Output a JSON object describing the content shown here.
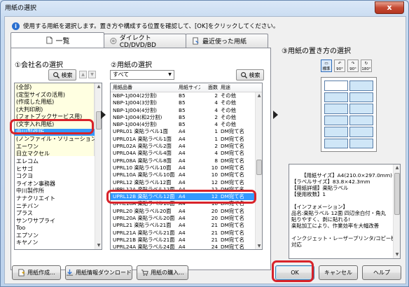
{
  "window": {
    "title": "用紙の選択",
    "close_label": "x"
  },
  "instruction": "使用する用紙を選択します。置き方や構成する位置を確認して、[OK]をクリックしてください。",
  "tabs": [
    {
      "label": "一覧"
    },
    {
      "label": "ダイレクトCD/DVD/BD"
    },
    {
      "label": "最近使った用紙"
    }
  ],
  "company_section": {
    "heading": "①会社名の選択",
    "search_label": "検索",
    "items": [
      "(全部)",
      "(定型サイズの活用)",
      "(作成した用紙)",
      "(大判印刷)",
      "(フォトブックサービス用)",
      "(文字入れ用紙)",
      "中川製作所",
      "(ノンファイル・ソリューション)",
      "エーワン",
      "日立マクセル",
      "エレコム",
      "ヒサゴ",
      "コクヨ",
      "ライオン事務器",
      "中川製作所",
      "ナナクリエイト",
      "ニチバン",
      "プラス",
      "サンワサプライ",
      "Too",
      "エプソン",
      "キヤノン"
    ],
    "selected_index": 6
  },
  "paper_section": {
    "heading": "②用紙の選択",
    "filter_value": "すべて",
    "search_label": "検索",
    "columns": [
      "用紙品番",
      "用紙サイズ",
      "面数",
      "用途"
    ],
    "rows": [
      [
        "NBP-1J004(2分割)",
        "B5",
        "2",
        "その他"
      ],
      [
        "NBP-1J004(3分割)",
        "B5",
        "4",
        "その他"
      ],
      [
        "NBP-1J004(4分割)",
        "B5",
        "4",
        "その他"
      ],
      [
        "NBP-1J004(和2分割)",
        "B5",
        "2",
        "その他"
      ],
      [
        "NBP-1J004(4分割)",
        "B5",
        "4",
        "その他"
      ],
      [
        "UPRL01 楽貼ラベル1面",
        "A4",
        "1",
        "DM宛て名"
      ],
      [
        "UPRL01A 楽貼ラベル1面",
        "A4",
        "1",
        "DM宛て名"
      ],
      [
        "UPRL02A 楽貼ラベル2面",
        "A4",
        "2",
        "DM宛て名"
      ],
      [
        "UPRL04A 楽貼ラベル4面",
        "A4",
        "4",
        "DM宛て名"
      ],
      [
        "UPRL08A 楽貼ラベル8面",
        "A4",
        "8",
        "DM宛て名"
      ],
      [
        "UPRL10 楽貼ラベル10面",
        "A4",
        "10",
        "DM宛て名"
      ],
      [
        "UPRL10A 楽貼ラベル10面",
        "A4",
        "10",
        "DM宛て名"
      ],
      [
        "UPRL12 楽貼ラベル12面",
        "A4",
        "12",
        "DM宛て名"
      ],
      [
        "UPRL12A 楽貼ラベル12面",
        "A4",
        "12",
        "DM宛て名"
      ],
      [
        "UPRL12B 楽貼ラベル12面 ...",
        "A4",
        "12",
        "DM宛て名"
      ],
      [
        "UPRL18A 楽貼ラベル18面",
        "A4",
        "18",
        "DM宛て名"
      ],
      [
        "UPRL20 楽貼ラベル20面",
        "A4",
        "20",
        "DM宛て名"
      ],
      [
        "UPRL20A 楽貼ラベル20面",
        "A4",
        "20",
        "DM宛て名"
      ],
      [
        "UPRL21 楽貼ラベル21面",
        "A4",
        "21",
        "DM宛て名"
      ],
      [
        "UPRL21A 楽貼ラベル21面",
        "A4",
        "21",
        "DM宛て名"
      ],
      [
        "UPRL21B 楽貼ラベル21面",
        "A4",
        "21",
        "DM宛て名"
      ],
      [
        "UPRL24A 楽貼ラベル24面",
        "A4",
        "24",
        "DM宛て名"
      ],
      [
        "UPRL24 楽貼ラベル24面",
        "A4",
        "24",
        "DM宛て名"
      ]
    ],
    "selected_index": 14
  },
  "placement_section": {
    "heading": "③用紙の置き方の選択",
    "options": [
      "標準",
      "90°",
      "90°",
      "180°"
    ],
    "selected_index": 0,
    "rows": 6,
    "cols": 2
  },
  "info_text": "【用紙サイズ】A4(210.0×297.0mm)\n【ラベルサイズ】83.8×42.3mm\n【用紙詳細】楽貼ラベル\n【使用枚数】1\n\n【インフォメーション】\n品名:楽貼ラベル 12面 四辺余白付・角丸\n貼りやすく、剥に貼れる!\n楽貼加工により、作業効率を大幅改善\n\nインクジェット・レーザープリンタ/コピー機 対応",
  "buttons": {
    "create": "用紙作成...",
    "download": "用紙情報ダウンロード",
    "purchase": "用紙の購入...",
    "ok": "OK",
    "cancel": "キャンセル",
    "help": "ヘルプ"
  }
}
